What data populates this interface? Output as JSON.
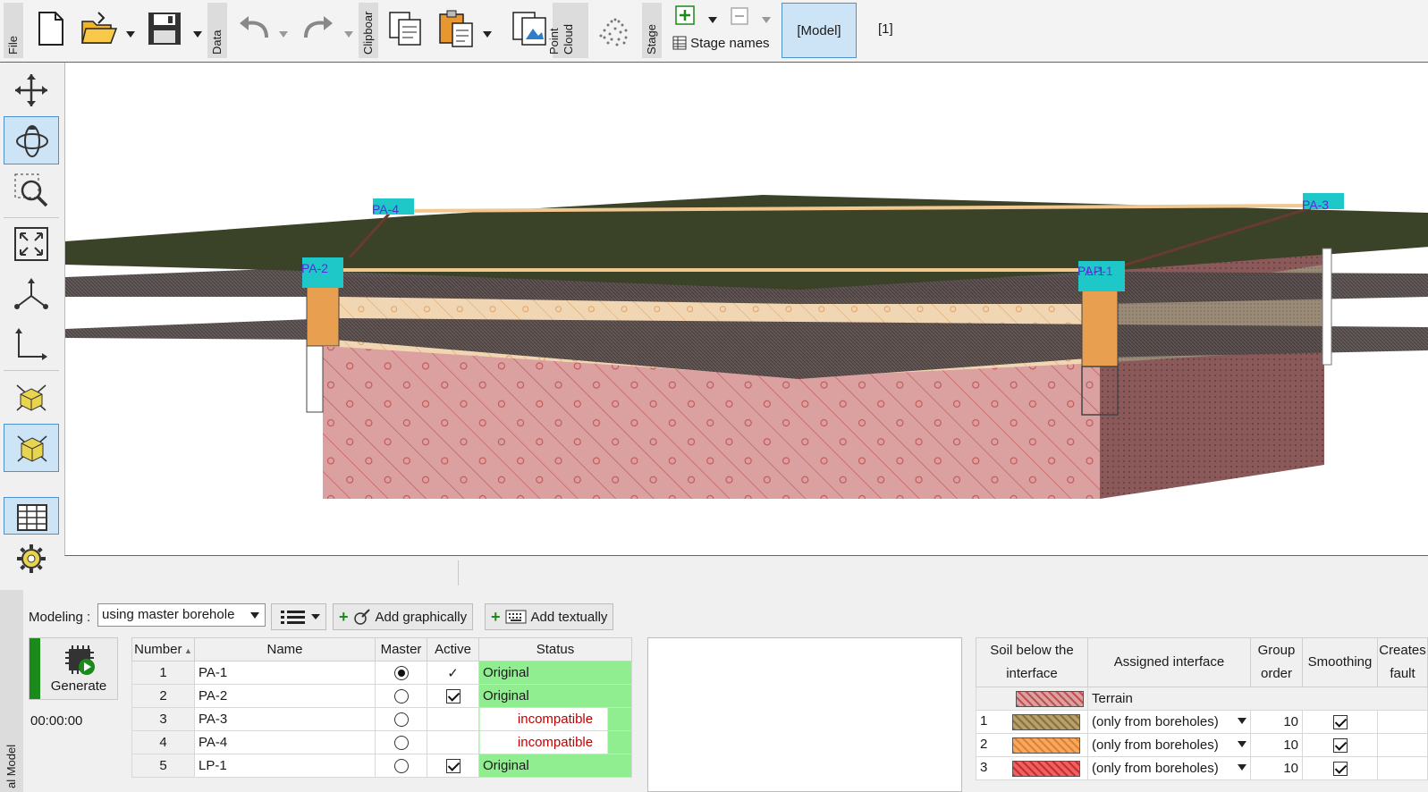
{
  "toolbar": {
    "tabs": {
      "file": "File",
      "data": "Data",
      "clipboard": "Clipboar",
      "point_cloud": "Point Cloud",
      "stage": "Stage"
    },
    "buttons": [
      "new-file",
      "open-file",
      "save-file",
      "undo",
      "redo",
      "copy",
      "paste",
      "copy-view",
      "point-cloud"
    ],
    "stage_names_label": "Stage names",
    "model_tab_label": "[Model]",
    "stage_one_label": "[1]"
  },
  "left_tools": [
    "move",
    "rotate",
    "zoom-window",
    "zoom-fit",
    "axes",
    "axes-2d",
    "view-box-wire",
    "view-box-solid",
    "table",
    "settings"
  ],
  "viewport": {
    "boreholes": [
      {
        "label": "PA-4"
      },
      {
        "label": "PA-2"
      },
      {
        "label": "PA-3"
      },
      {
        "label": "PA-1"
      },
      {
        "label": "LP-1"
      }
    ]
  },
  "bottom": {
    "side_label": "al Model",
    "modeling_label": "Modeling :",
    "modeling_value": "using master borehole",
    "add_graphically": "Add graphically",
    "add_textually": "Add textually",
    "generate": "Generate",
    "time": "00:00:00",
    "boreholes": {
      "headers": [
        "Number",
        "Name",
        "Master",
        "Active",
        "Status"
      ],
      "rows": [
        {
          "number": "1",
          "name": "PA-1",
          "master": true,
          "active": "tick",
          "status": "Original"
        },
        {
          "number": "2",
          "name": "PA-2",
          "master": false,
          "active": "checked",
          "status": "Original"
        },
        {
          "number": "3",
          "name": "PA-3",
          "master": false,
          "active": "none",
          "status": "incompatible"
        },
        {
          "number": "4",
          "name": "PA-4",
          "master": false,
          "active": "none",
          "status": "incompatible"
        },
        {
          "number": "5",
          "name": "LP-1",
          "master": false,
          "active": "checked",
          "status": "Original"
        }
      ]
    },
    "interfaces": {
      "headers": [
        "Soil below the interface",
        "Assigned interface",
        "Group order",
        "Smoothing",
        "Creates fault"
      ],
      "terrain_label": "Terrain",
      "rows": [
        {
          "number": "1",
          "swatch": "#b8a06a",
          "interface": "(only from boreholes)",
          "group": "10",
          "smoothing": true
        },
        {
          "number": "2",
          "swatch": "#f5a860",
          "interface": "(only from boreholes)",
          "group": "10",
          "smoothing": true
        },
        {
          "number": "3",
          "swatch": "#f06060",
          "interface": "(only from boreholes)",
          "group": "10",
          "smoothing": true
        }
      ]
    }
  },
  "colors": {
    "accent": "#2f6fb0",
    "selected": "#cde4f7",
    "ok_green": "#90ee90",
    "error_red": "#c00000",
    "terrain": "#3a4228"
  }
}
